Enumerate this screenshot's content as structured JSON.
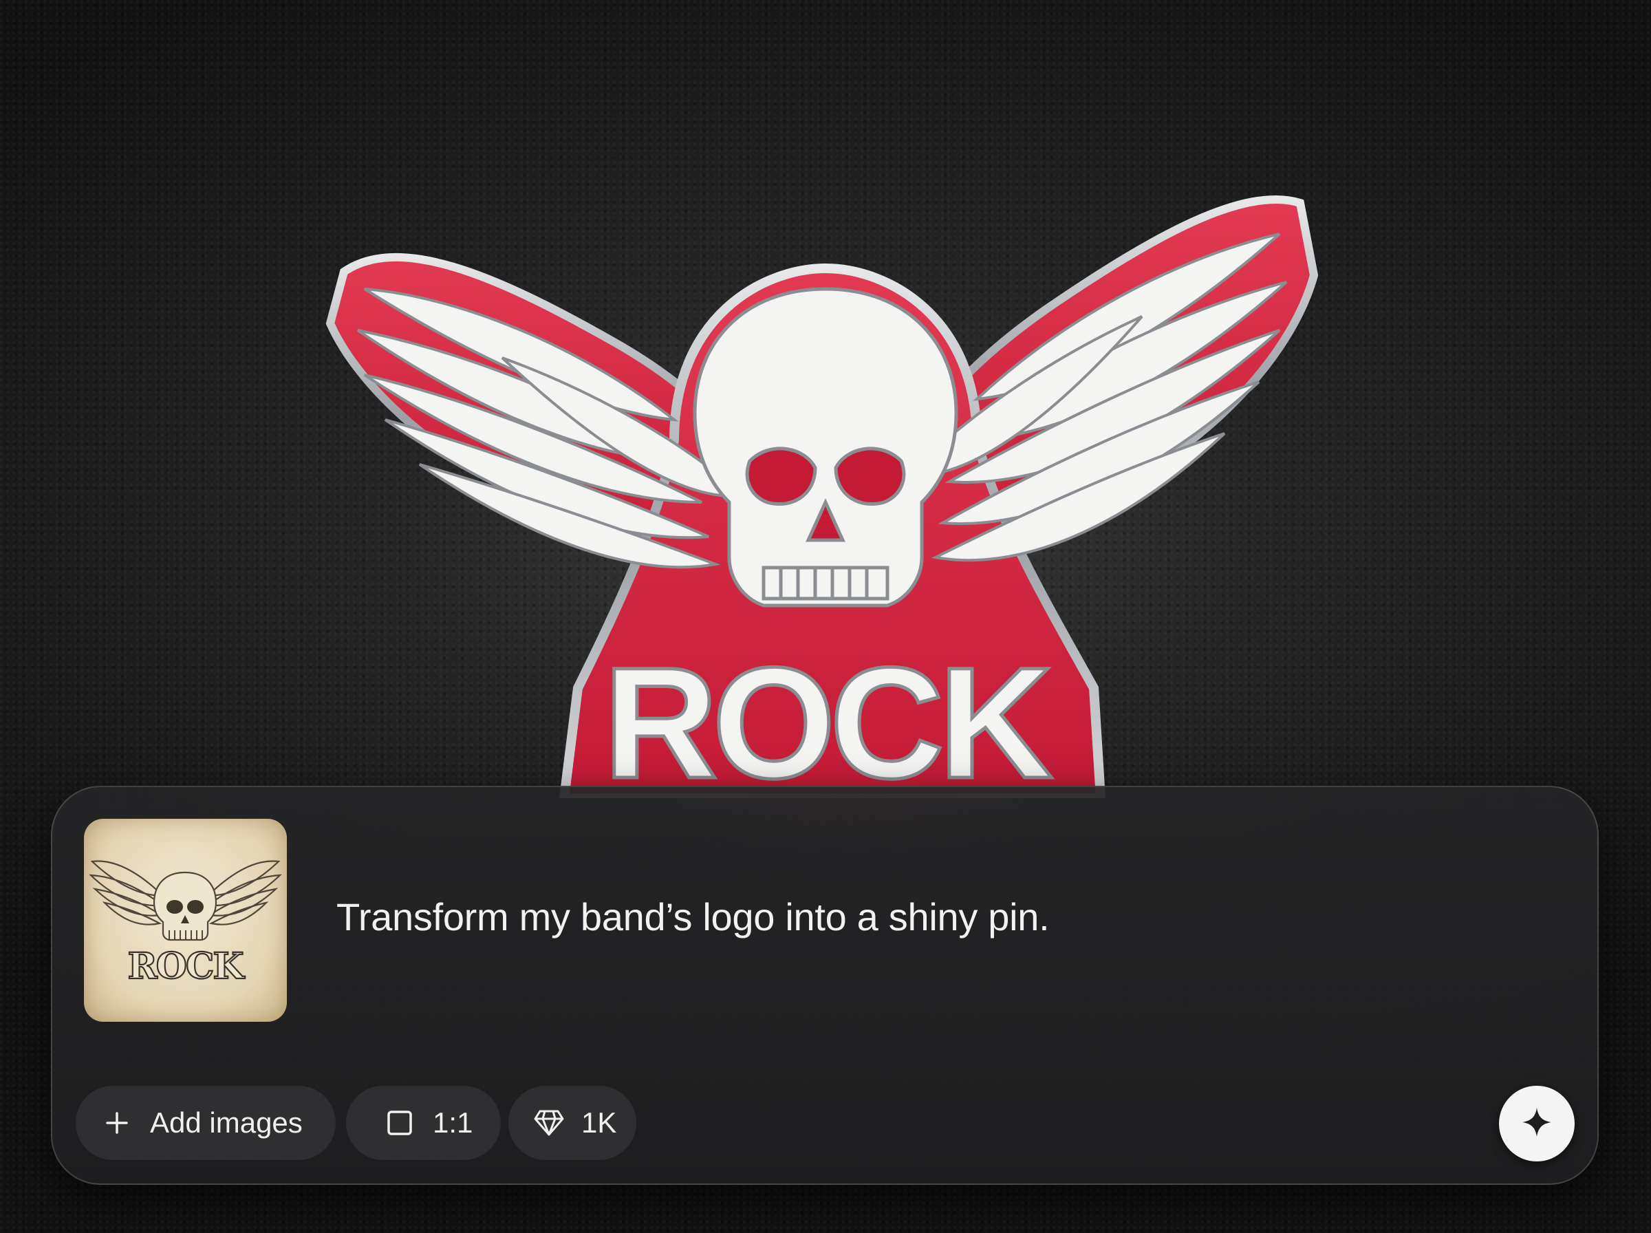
{
  "background": {
    "pin_badge_text": "ROCK"
  },
  "composer": {
    "reference_image": {
      "text": "ROCK"
    },
    "prompt_text": "Transform my band’s logo into a shiny pin.",
    "controls": {
      "add_images_label": "Add images",
      "aspect_ratio_label": "1:1",
      "resolution_label": "1K"
    },
    "send_button": {
      "icon": "sparkle-icon"
    }
  },
  "colors": {
    "pin_red": "#d8233f",
    "enamel_white": "#f4f4f2",
    "chrome": "#b9bcc0",
    "composer_bg": "#262628",
    "chip_bg": "#2f2f31",
    "send_bg": "#f4f4f4"
  }
}
